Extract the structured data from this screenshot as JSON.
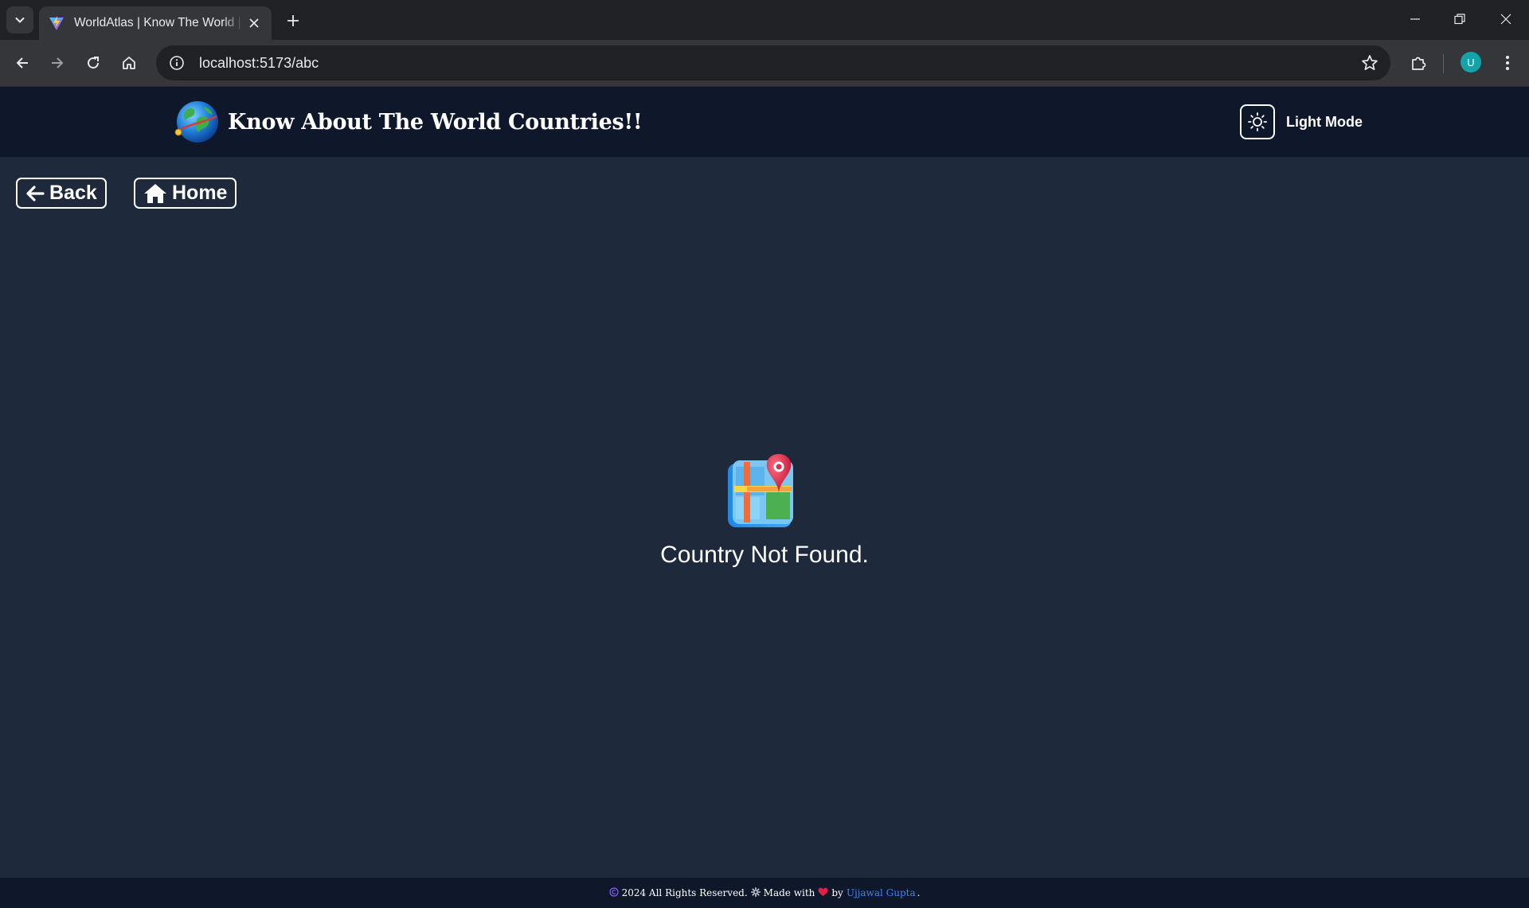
{
  "browser": {
    "tab_title": "WorldAtlas | Know The World | E",
    "url": "localhost:5173/abc",
    "profile_initial": "U"
  },
  "header": {
    "title": "Know About The World Countries!!",
    "theme_label": "Light Mode"
  },
  "nav": {
    "back_label": "Back",
    "home_label": "Home"
  },
  "main": {
    "message": "Country Not Found."
  },
  "footer": {
    "copyright_text": "2024 All Rights Reserved.",
    "made_with": "Made with",
    "by": "by",
    "author": "Ujjawal Gupta",
    "author_color": "#3b82f6"
  },
  "colors": {
    "header_bg": "#0f172a",
    "page_bg": "#1e293b"
  }
}
